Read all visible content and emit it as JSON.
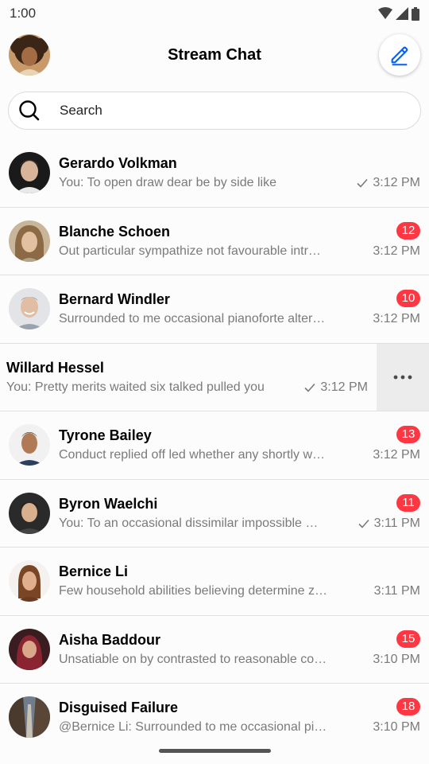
{
  "status_bar": {
    "time": "1:00"
  },
  "header": {
    "title": "Stream Chat"
  },
  "search": {
    "placeholder": "Search"
  },
  "channels": [
    {
      "name": "Gerardo Volkman",
      "preview": "You: To open draw dear be by side like",
      "time": "3:12 PM",
      "unread": "",
      "read_check": true
    },
    {
      "name": "Blanche Schoen",
      "preview": "Out particular sympathize not favourable intr…",
      "time": "3:12 PM",
      "unread": "12",
      "read_check": false
    },
    {
      "name": "Bernard Windler",
      "preview": "Surrounded to me occasional pianoforte alter…",
      "time": "3:12 PM",
      "unread": "10",
      "read_check": false
    },
    {
      "name": "Willard Hessel",
      "preview": "You: Pretty merits waited six talked pulled you",
      "time": "3:12 PM",
      "unread": "",
      "read_check": true
    },
    {
      "name": "Tyrone Bailey",
      "preview": "Conduct replied off led whether any shortly w…",
      "time": "3:12 PM",
      "unread": "13",
      "read_check": false
    },
    {
      "name": "Byron Waelchi",
      "preview": "You: To an occasional dissimilar impossible …",
      "time": "3:11 PM",
      "unread": "11",
      "read_check": true
    },
    {
      "name": "Bernice Li",
      "preview": "Few household abilities believing determine z…",
      "time": "3:11 PM",
      "unread": "",
      "read_check": false
    },
    {
      "name": "Aisha Baddour",
      "preview": "Unsatiable on by contrasted to reasonable co…",
      "time": "3:10 PM",
      "unread": "15",
      "read_check": false
    },
    {
      "name": "Disguised Failure",
      "preview": "@Bernice Li: Surrounded to me occasional pi…",
      "time": "3:10 PM",
      "unread": "18",
      "read_check": false
    }
  ],
  "colors": {
    "accent": "#005fff",
    "badge": "#ff3742",
    "muted_text": "#7a7a7a",
    "divider": "#e0e0e0"
  },
  "icons": {
    "header_left": "user-avatar",
    "header_right": "pencil-edit-icon",
    "search": "search-icon",
    "read": "checkmark-icon",
    "swipe_action": "more-horizontal-icon"
  }
}
